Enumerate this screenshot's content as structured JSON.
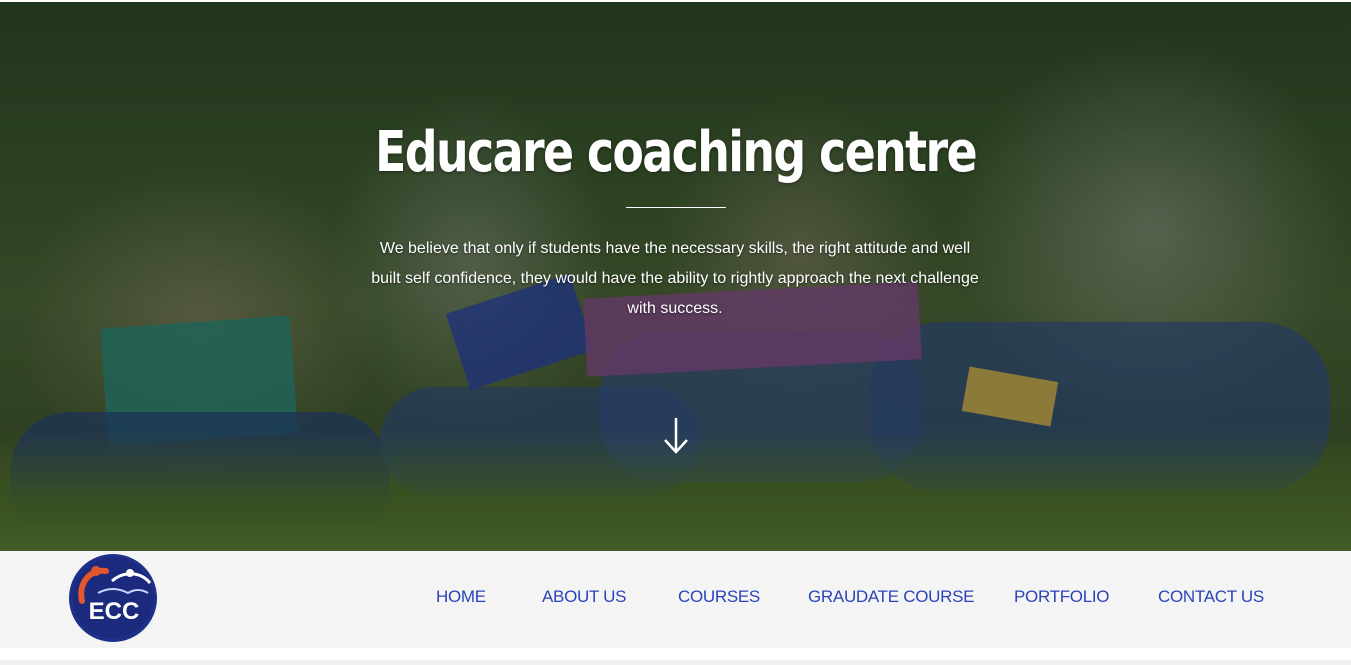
{
  "hero": {
    "title": "Educare coaching centre",
    "description": "We believe that only if students have the necessary skills, the right attitude and well built self confidence, they would have the ability to rightly approach the next challenge with success.",
    "scroll_icon": "arrow-down-icon"
  },
  "logo": {
    "text": "ECC",
    "colors": {
      "ring": "#1e2f8a",
      "accent": "#e2572b"
    }
  },
  "nav": {
    "items": [
      {
        "label": "HOME"
      },
      {
        "label": "ABOUT US"
      },
      {
        "label": "COURSES"
      },
      {
        "label": "GRAUDATE COURSE"
      },
      {
        "label": "PORTFOLIO"
      },
      {
        "label": "CONTACT US"
      }
    ],
    "color": "#2a44b8"
  }
}
